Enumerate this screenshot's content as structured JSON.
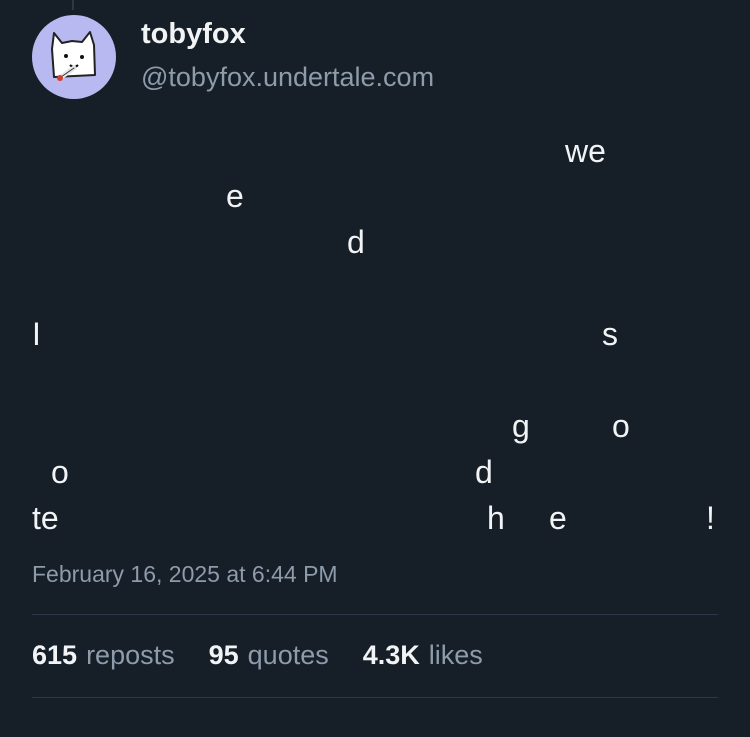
{
  "author": {
    "display_name": "tobyfox",
    "handle": "@tobyfox.undertale.com",
    "avatar_icon": "white-dog-smoking-cigarette",
    "avatar_bg": "#b9b9f1"
  },
  "post": {
    "visible_fragments": [
      "we",
      "e",
      "d",
      "I",
      "s",
      "g",
      "o",
      "o",
      "d",
      "te",
      "h",
      "e",
      "!"
    ]
  },
  "meta": {
    "timestamp": "February 16, 2025 at 6:44 PM"
  },
  "stats": {
    "reposts_count": "615",
    "reposts_label": "reposts",
    "quotes_count": "95",
    "quotes_label": "quotes",
    "likes_count": "4.3K",
    "likes_label": "likes"
  },
  "colors": {
    "background": "#161e27",
    "text_primary": "#f1f3f5",
    "text_secondary": "#8d9bab",
    "divider": "#2b3847"
  }
}
